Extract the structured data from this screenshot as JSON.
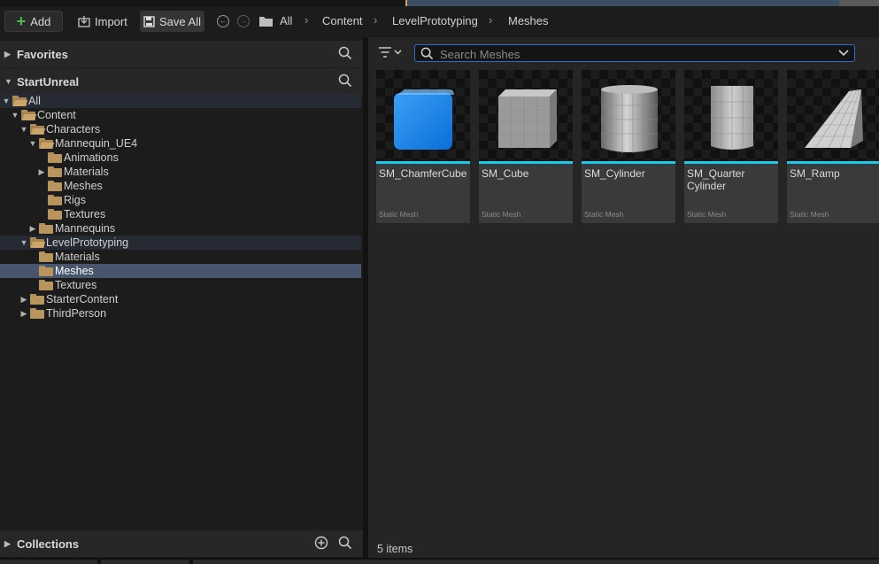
{
  "toolbar": {
    "add_label": "Add",
    "import_label": "Import",
    "save_all_label": "Save All"
  },
  "breadcrumb": [
    "All",
    "Content",
    "LevelPrototyping",
    "Meshes"
  ],
  "left_panel": {
    "favorites_label": "Favorites",
    "project_label": "StartUnreal",
    "collections_label": "Collections",
    "tree": [
      {
        "label": "All",
        "state": "expanded",
        "open": true
      },
      {
        "label": "Content",
        "state": "expanded",
        "open": true
      },
      {
        "label": "Characters",
        "state": "expanded",
        "open": true
      },
      {
        "label": "Mannequin_UE4",
        "state": "expanded",
        "open": true
      },
      {
        "label": "Animations",
        "state": "leaf",
        "open": false
      },
      {
        "label": "Materials",
        "state": "collapsed",
        "open": false
      },
      {
        "label": "Meshes",
        "state": "leaf",
        "open": false
      },
      {
        "label": "Rigs",
        "state": "leaf",
        "open": false
      },
      {
        "label": "Textures",
        "state": "leaf",
        "open": false
      },
      {
        "label": "Mannequins",
        "state": "collapsed",
        "open": false
      },
      {
        "label": "LevelPrototyping",
        "state": "expanded",
        "open": true
      },
      {
        "label": "Materials",
        "state": "leaf",
        "open": false
      },
      {
        "label": "Meshes",
        "state": "leaf",
        "open": false,
        "selected": true
      },
      {
        "label": "Textures",
        "state": "leaf",
        "open": false
      },
      {
        "label": "StarterContent",
        "state": "collapsed",
        "open": false
      },
      {
        "label": "ThirdPerson",
        "state": "collapsed",
        "open": false
      }
    ]
  },
  "search": {
    "placeholder": "Search Meshes",
    "value": ""
  },
  "assets": [
    {
      "name": "SM_ChamferCube",
      "type": "Static Mesh",
      "shape": "chamfer-cube"
    },
    {
      "name": "SM_Cube",
      "type": "Static Mesh",
      "shape": "cube"
    },
    {
      "name": "SM_Cylinder",
      "type": "Static Mesh",
      "shape": "cylinder"
    },
    {
      "name": "SM_Quarter Cylinder",
      "type": "Static Mesh",
      "shape": "quarter-cylinder"
    },
    {
      "name": "SM_Ramp",
      "type": "Static Mesh",
      "shape": "ramp"
    }
  ],
  "status": {
    "item_count": "5 items"
  },
  "colors": {
    "accent_blue": "#2d6bd0",
    "asset_bar": "#1ec8e6",
    "selected_row": "#48566d",
    "folder": "#b8955f"
  }
}
